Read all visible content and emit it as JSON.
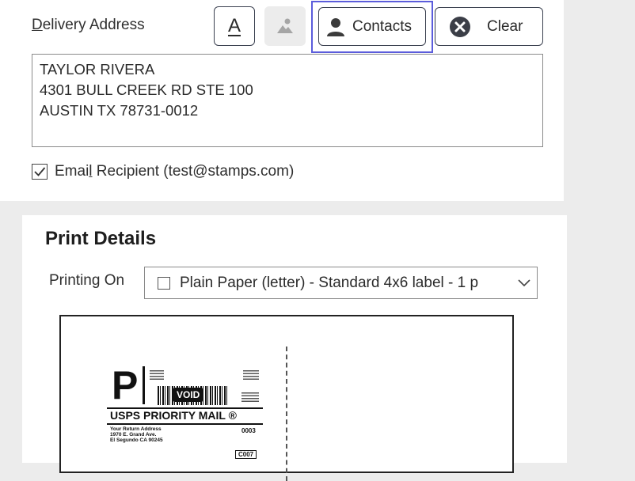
{
  "delivery": {
    "label_prefix": "D",
    "label_rest": "elivery Address",
    "text_btn_glyph": "A",
    "contacts_label": "Contacts",
    "clear_label": "Clear",
    "address_text": "TAYLOR RIVERA\n4301 BULL CREEK RD STE 100\nAUSTIN TX 78731-0012",
    "email_label_pre": "Emai",
    "email_label_mnemonic": "l",
    "email_label_post": " Recipient (test@stamps.com)",
    "email_checked": true
  },
  "print": {
    "title": "Print Details",
    "printing_on_label": "Printing On",
    "printing_on_value": "Plain Paper (letter) - Standard 4x6 label - 1 p",
    "preview": {
      "service_letter": "P",
      "void_text": "VOID",
      "service_name": "USPS PRIORITY MAIL ®",
      "return_line1": "Your Return Address",
      "return_line2": "1970 E. Grand Ave.",
      "return_line3": "El Segundo CA 90245",
      "code1": "0003",
      "code2": "C007"
    }
  },
  "colors": {
    "focus": "#5b5cdb",
    "panel": "#ffffff",
    "background": "#ececec"
  }
}
